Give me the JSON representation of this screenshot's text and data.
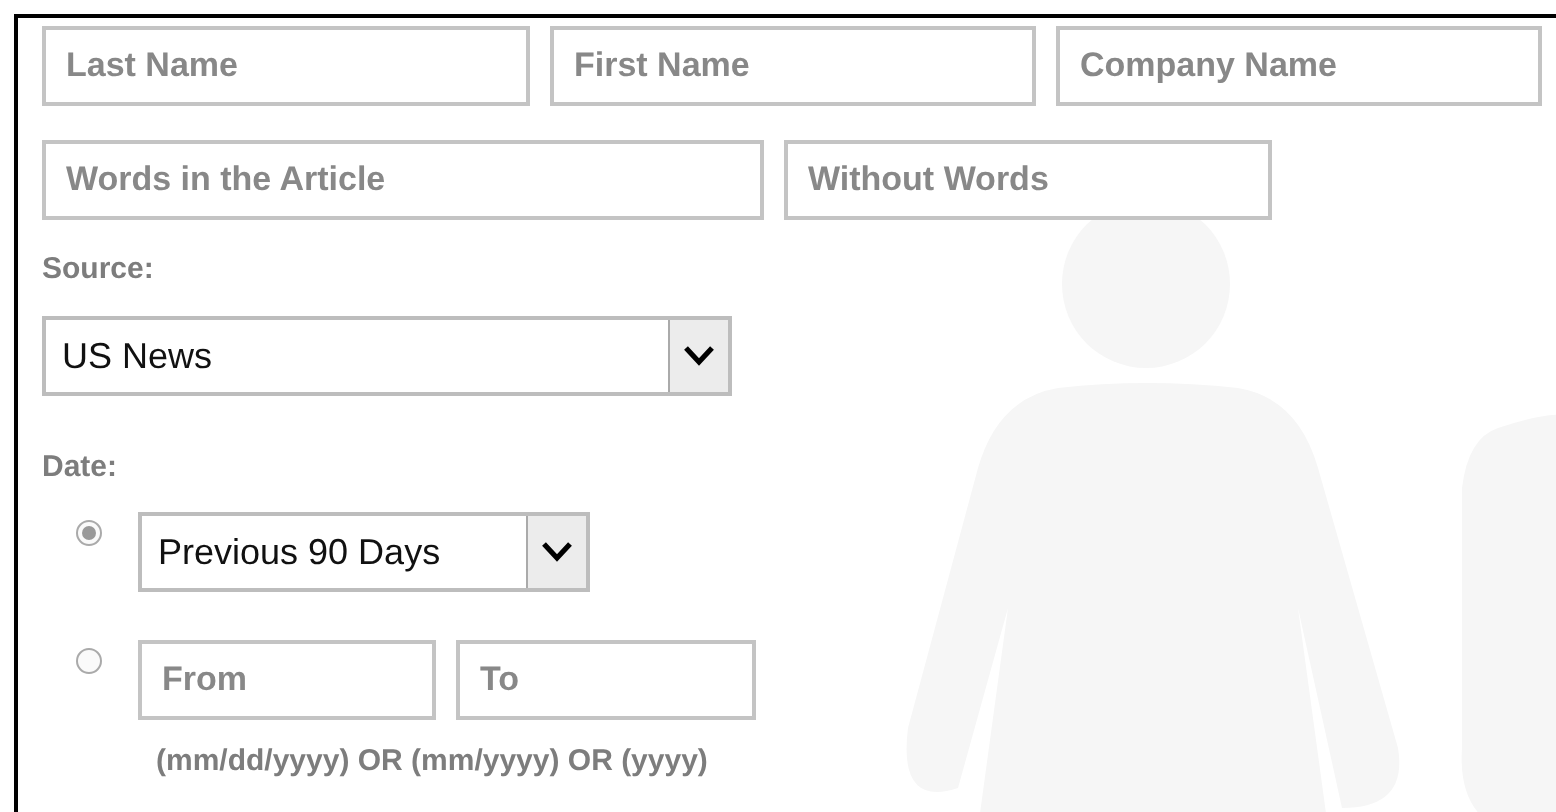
{
  "name_fields": [
    {
      "placeholder": "Last Name"
    },
    {
      "placeholder": "First Name"
    },
    {
      "placeholder": "Company Name"
    }
  ],
  "word_fields": [
    {
      "placeholder": "Words in the Article"
    },
    {
      "placeholder": "Without Words"
    }
  ],
  "source": {
    "label": "Source:",
    "value": "US News"
  },
  "date": {
    "label": "Date:",
    "options": [
      {
        "kind": "preset",
        "selected": true,
        "value": "Previous 90 Days"
      },
      {
        "kind": "range",
        "selected": false,
        "from_placeholder": "From",
        "to_placeholder": "To"
      }
    ],
    "hint": "(mm/dd/yyyy) OR (mm/yyyy) OR (yyyy)"
  }
}
